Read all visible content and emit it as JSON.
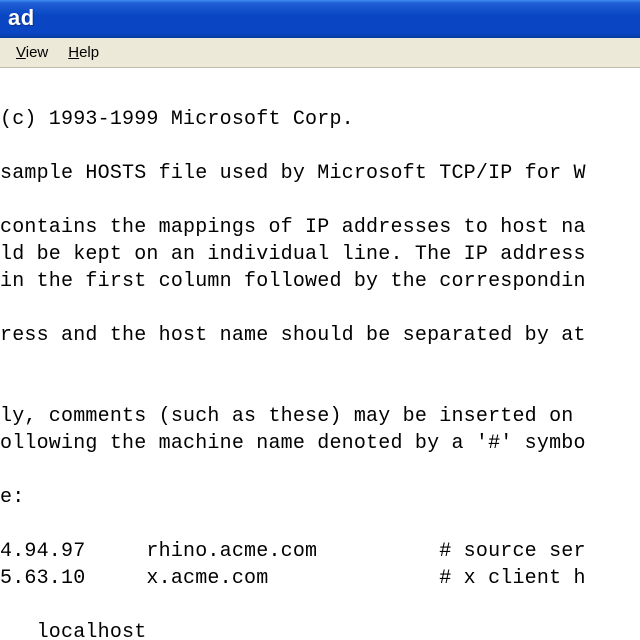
{
  "window": {
    "title_fragment": "ad"
  },
  "menu": {
    "view": "View",
    "help": "Help"
  },
  "text": {
    "l0": "(c) 1993-1999 Microsoft Corp.",
    "l1": "",
    "l2": "sample HOSTS file used by Microsoft TCP/IP for W",
    "l3": "",
    "l4": "contains the mappings of IP addresses to host na",
    "l5": "ld be kept on an individual line. The IP address",
    "l6": "in the first column followed by the correspondin",
    "l7": "",
    "l8": "ress and the host name should be separated by at",
    "l9": "",
    "l10": "",
    "l11": "ly, comments (such as these) may be inserted on ",
    "l12": "ollowing the machine name denoted by a '#' symbo",
    "l13": "",
    "l14": "e:",
    "l15": "",
    "l16": "4.94.97     rhino.acme.com          # source ser",
    "l17": "5.63.10     x.acme.com              # x client h",
    "l18": "",
    "l19": "   localhost"
  }
}
